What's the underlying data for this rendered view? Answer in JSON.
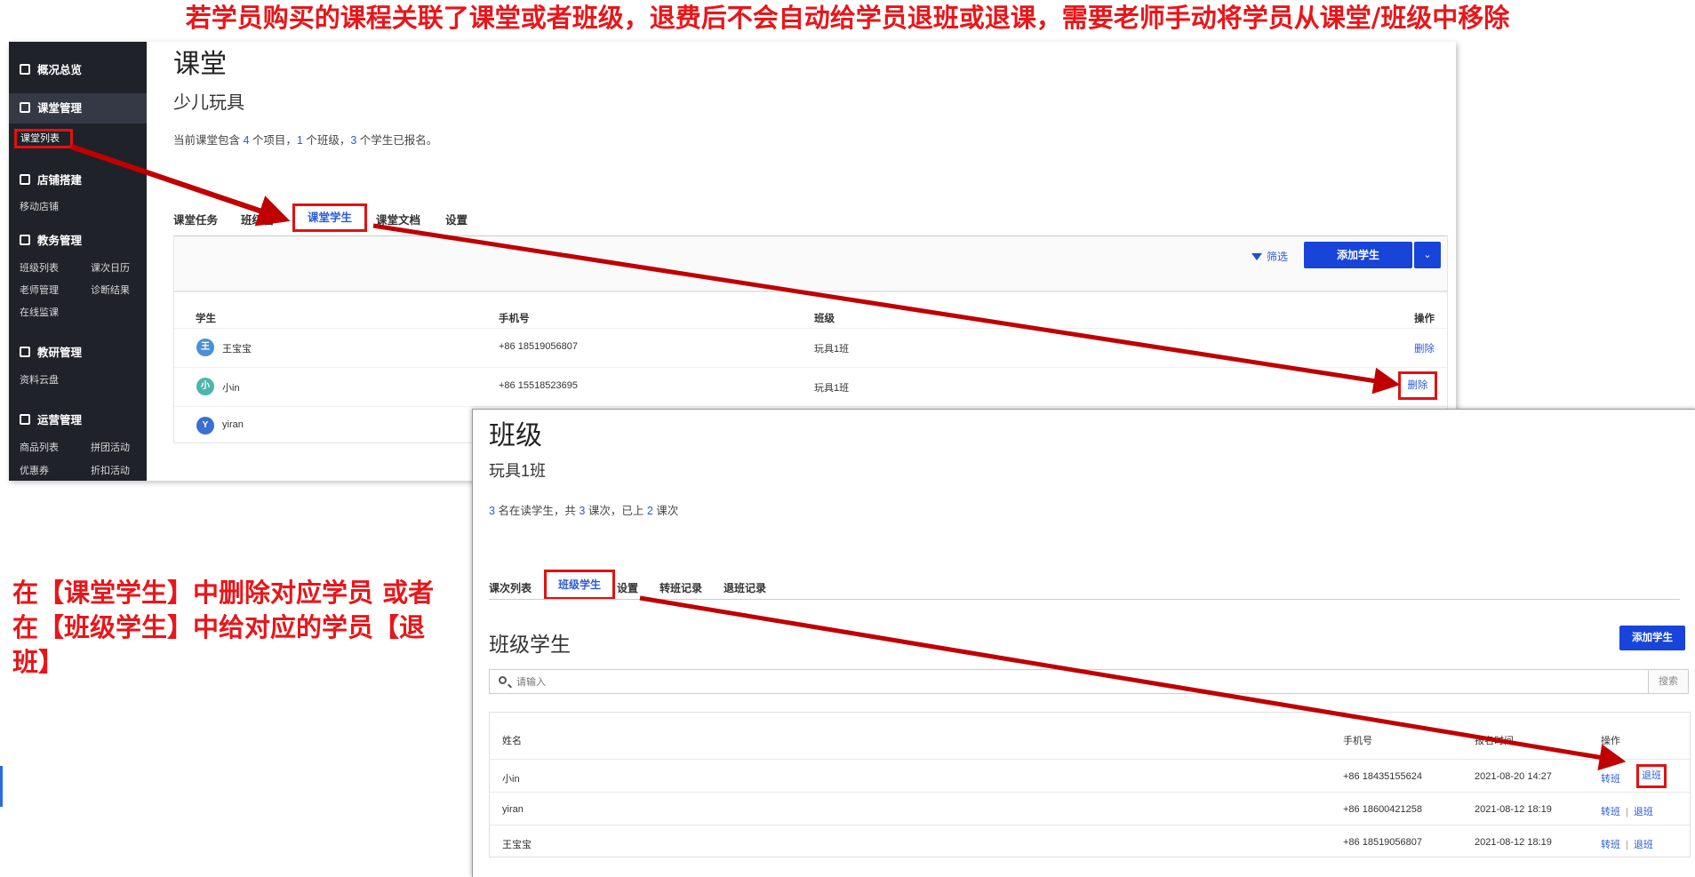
{
  "annotation": {
    "top_text": "若学员购买的课程关联了课堂或者班级，退费后不会自动给学员退班或退课，需要老师手动将学员从课堂/班级中移除",
    "side_line1": "在【课堂学生】中删除对应学员  或者",
    "side_line2": "在【班级学生】中给对应的学员【退",
    "side_line3": "班】",
    "highlight_color": "#e01212"
  },
  "sidebar": {
    "overview": "概况总览",
    "classroom_mgmt": "课堂管理",
    "classroom_list": "课堂列表",
    "shop_build": "店铺搭建",
    "mobile_shop": "移动店铺",
    "teaching_mgmt": "教务管理",
    "class_list": "班级列表",
    "lesson_calendar": "课次日历",
    "teacher_mgmt": "老师管理",
    "diagnosis": "诊断结果",
    "online_monitor": "在线监课",
    "research_mgmt": "教研管理",
    "cloud_drive": "资料云盘",
    "ops_mgmt": "运营管理",
    "product_list": "商品列表",
    "group_buy": "拼团活动",
    "coupon": "优惠券",
    "discount": "折扣活动"
  },
  "classroom": {
    "title": "课堂",
    "name": "少儿玩具",
    "summary_pre": "当前课堂包含 ",
    "items": "4",
    "summary_mid1": " 个项目，",
    "classes": "1",
    "summary_mid2": " 个班级，",
    "students": "3",
    "summary_post": " 个学生已报名。",
    "tabs": {
      "tasks": "课堂任务",
      "classes": "班级管",
      "students": "课堂学生",
      "docs": "课堂文档",
      "settings": "设置"
    },
    "filter": "筛选",
    "add_student": "添加学生",
    "columns": {
      "student": "学生",
      "phone": "手机号",
      "class": "班级",
      "action": "操作"
    },
    "rows": [
      {
        "avatar": "王",
        "name": "王宝宝",
        "phone": "+86 18519056807",
        "class": "玩具1班",
        "action": "删除"
      },
      {
        "avatar": "小",
        "name": "小in",
        "phone": "+86 15518523695",
        "class": "玩具1班",
        "action": "删除"
      },
      {
        "avatar": "Y",
        "name": "yiran"
      }
    ]
  },
  "class_panel": {
    "title": "班级",
    "name": "玩具1班",
    "n_students": "3",
    "t1": " 名在读学生，共 ",
    "n_lessons": "3",
    "t2": " 课次，已上 ",
    "n_done": "2",
    "t3": " 课次",
    "tabs": {
      "lessons": "课次列表",
      "students": "班级学生",
      "settings": "设置",
      "transfer_log": "转班记录",
      "leave_log": "退班记录"
    },
    "section_title": "班级学生",
    "add_student": "添加学生",
    "search_placeholder": "请输入",
    "search_btn": "搜索",
    "columns": {
      "name": "姓名",
      "phone": "手机号",
      "signup": "报名时间",
      "action": "操作"
    },
    "rows": [
      {
        "name": "小in",
        "phone": "+86 18435155624",
        "time": "2021-08-20 14:27",
        "transfer": "转班",
        "leave": "退班"
      },
      {
        "name": "yiran",
        "phone": "+86 18600421258",
        "time": "2021-08-12 18:19",
        "transfer": "转班",
        "leave": "退班"
      },
      {
        "name": "王宝宝",
        "phone": "+86 18519056807",
        "time": "2021-08-12 18:19",
        "transfer": "转班",
        "leave": "退班"
      }
    ]
  }
}
